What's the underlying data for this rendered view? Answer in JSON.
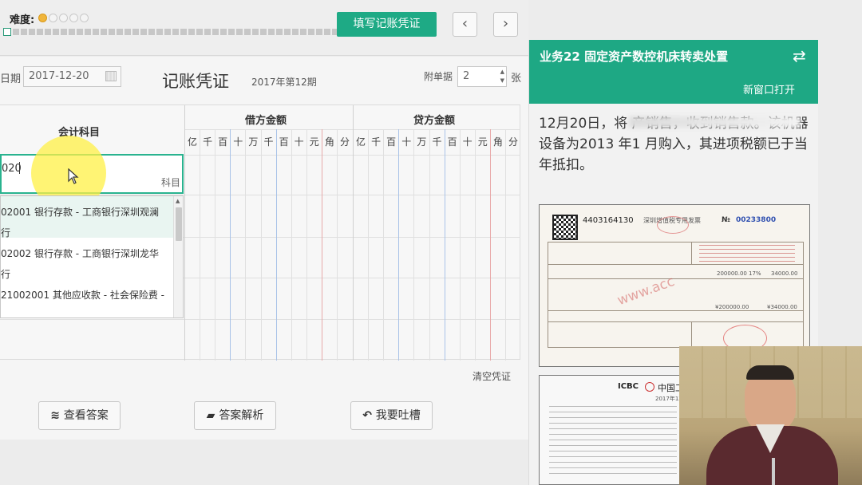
{
  "header": {
    "difficulty_label": "难度:",
    "difficulty": {
      "filled": 1,
      "total": 5
    },
    "progress": {
      "current": 1,
      "total": 44
    },
    "fill_button": "填写记账凭证",
    "prev_icon": "chevron-left-icon",
    "prev_glyph": "‹",
    "next_icon": "chevron-right-icon",
    "next_glyph": "›"
  },
  "voucher": {
    "date_label": "日期",
    "date_value": "2017-12-20",
    "calendar_icon": "calendar-icon",
    "title": "记账凭证",
    "period": "2017年第12期",
    "attachments_label": "附单据",
    "attachments_value": "2",
    "attachments_unit": "张",
    "columns": {
      "subject": "会计科目",
      "debit": "借方金额",
      "credit": "贷方金额",
      "digit_units": [
        "亿",
        "千",
        "百",
        "十",
        "万",
        "千",
        "百",
        "十",
        "元",
        "角",
        "分"
      ]
    },
    "subject_input_value": "020",
    "subject_input_suffix": "科目",
    "dropdown_items": [
      {
        "line1": "02001 银行存款 - 工商银行深圳观澜",
        "line2": "行"
      },
      {
        "line1": "02002 银行存款 - 工商银行深圳龙华",
        "line2": "行"
      },
      {
        "line1": "21002001 其他应收款 - 社会保险费 -",
        "line2": ""
      }
    ],
    "clear_link": "清空凭证",
    "actions": [
      {
        "icon": "database-icon",
        "glyph": "≋",
        "label": "查看答案"
      },
      {
        "icon": "folder-open-icon",
        "glyph": "▰",
        "label": "答案解析"
      },
      {
        "icon": "reply-icon",
        "glyph": "↶",
        "label": "我要吐槽"
      }
    ]
  },
  "task": {
    "title": "业务22 固定资产数控机床转卖处置",
    "swap_icon": "swap-icon",
    "swap_glyph": "⇄",
    "new_window": "新窗口打开",
    "description": "12月20日，将                              产销售，收到销售款。该机器设备为2013 年1 月购入，其进项税额已于当年抵扣。",
    "invoice1": {
      "code": "4403164130",
      "title": "深圳增值税专用发票",
      "number_prefix": "№",
      "number": "00233800",
      "amount": "200000.00",
      "rate": "17%",
      "tax": "34000.00",
      "total": "¥200000.00",
      "total_tax": "¥34000.00",
      "watermark": "www.acc"
    },
    "invoice2": {
      "bank_logo": "ICBC",
      "bank_name": "中国工",
      "year_fragment": "2017年12"
    }
  },
  "colors": {
    "accent": "#1ea884",
    "highlight": "#fff36b"
  }
}
